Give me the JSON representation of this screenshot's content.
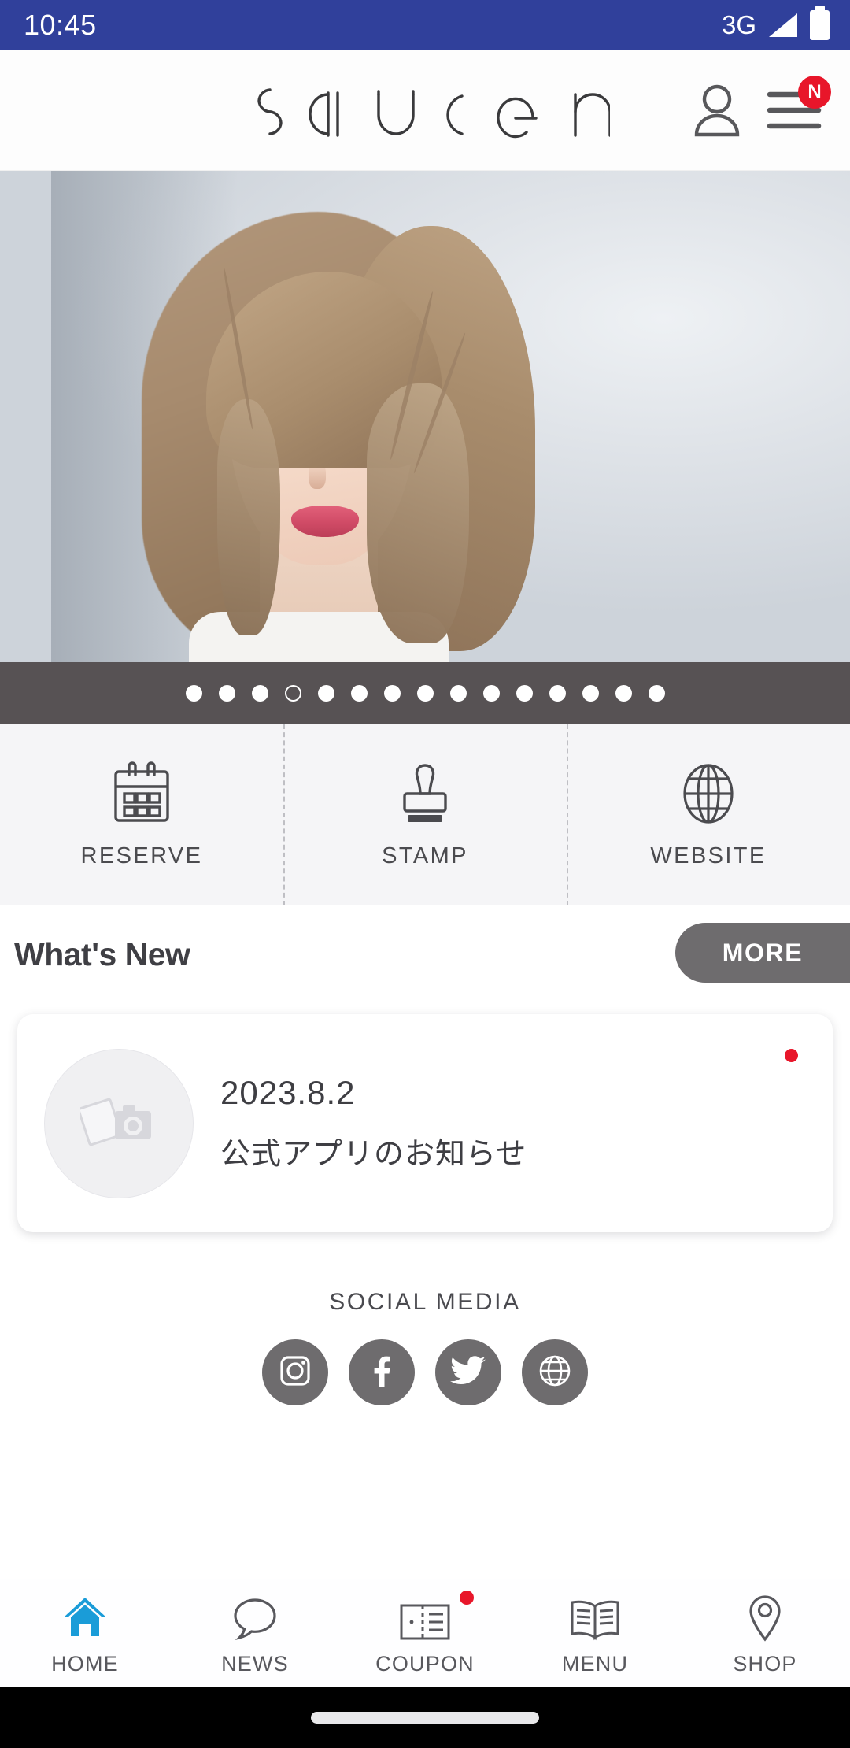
{
  "status_bar": {
    "time": "10:45",
    "network": "3G",
    "signal_icon": "signal-triangle-icon",
    "battery_icon": "battery-full-icon",
    "background_color": "#30409b"
  },
  "header": {
    "brand": "saucer",
    "account_icon": "person-icon",
    "menu_icon": "hamburger-menu-icon",
    "menu_badge": "N",
    "badge_color": "#e8162a"
  },
  "hero": {
    "alt": "hair-salon-model-portrait",
    "carousel": {
      "total_dots": 15,
      "active_index": 3,
      "band_color": "#575254"
    }
  },
  "quick_actions": [
    {
      "label": "RESERVE",
      "icon": "calendar-icon"
    },
    {
      "label": "STAMP",
      "icon": "stamp-icon"
    },
    {
      "label": "WEBSITE",
      "icon": "globe-icon"
    }
  ],
  "whats_new": {
    "title": "What's New",
    "more_label": "MORE",
    "more_color": "#6e6c6e",
    "items": [
      {
        "date": "2023.8.2",
        "title": "公式アプリのお知らせ",
        "thumbnail_icon": "photo-camera-placeholder-icon",
        "unread": true
      }
    ]
  },
  "social": {
    "title": "SOCIAL MEDIA",
    "icon_color": "#6e6c6e",
    "items": [
      {
        "name": "instagram",
        "icon": "instagram-icon"
      },
      {
        "name": "facebook",
        "icon": "facebook-icon"
      },
      {
        "name": "twitter",
        "icon": "twitter-icon"
      },
      {
        "name": "website",
        "icon": "globe-icon"
      }
    ]
  },
  "bottom_nav": {
    "active_color": "#1a9cd8",
    "items": [
      {
        "label": "HOME",
        "icon": "home-icon",
        "active": true,
        "badge": false
      },
      {
        "label": "NEWS",
        "icon": "speech-bubble-icon",
        "active": false,
        "badge": false
      },
      {
        "label": "COUPON",
        "icon": "coupon-ticket-icon",
        "active": false,
        "badge": true
      },
      {
        "label": "MENU",
        "icon": "open-book-icon",
        "active": false,
        "badge": false
      },
      {
        "label": "SHOP",
        "icon": "location-pin-icon",
        "active": false,
        "badge": false
      }
    ]
  },
  "gesture_bar": {
    "handle": "home-gesture-handle"
  }
}
